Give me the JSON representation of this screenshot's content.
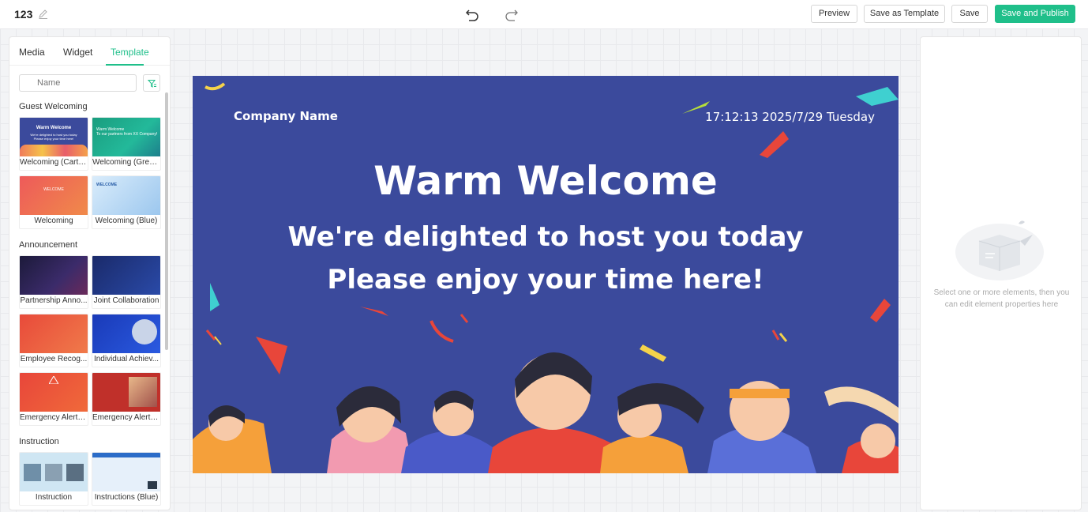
{
  "header": {
    "title": "123",
    "preview_label": "Preview",
    "save_template_label": "Save as Template",
    "save_label": "Save",
    "publish_label": "Save and Publish"
  },
  "left_panel": {
    "tabs": [
      {
        "label": "Media"
      },
      {
        "label": "Widget"
      },
      {
        "label": "Template",
        "active": true
      }
    ],
    "search_placeholder": "Name",
    "sections": [
      {
        "title": "Guest Welcoming",
        "templates": [
          {
            "label": "Welcoming (Carto..."
          },
          {
            "label": "Welcoming (Green)"
          },
          {
            "label": "Welcoming"
          },
          {
            "label": "Welcoming (Blue)"
          }
        ]
      },
      {
        "title": "Announcement",
        "templates": [
          {
            "label": "Partnership Anno..."
          },
          {
            "label": "Joint Collaboration"
          },
          {
            "label": "Employee Recog..."
          },
          {
            "label": "Individual Achiev..."
          },
          {
            "label": "Emergency Alert (..."
          },
          {
            "label": "Emergency Alert (..."
          }
        ]
      },
      {
        "title": "Instruction",
        "templates": [
          {
            "label": "Instruction"
          },
          {
            "label": "Instructions (Blue)"
          }
        ]
      }
    ]
  },
  "slide": {
    "company": "Company Name",
    "datetime": "17:12:13 2025/7/29 Tuesday",
    "headline": "Warm Welcome",
    "line1": "We're delighted to host you today",
    "line2": "Please enjoy your time here!",
    "background": "#3b4a9c"
  },
  "right_panel": {
    "empty_text": "Select one or more elements, then you can edit element properties here"
  },
  "colors": {
    "accent": "#1fbf8a"
  }
}
